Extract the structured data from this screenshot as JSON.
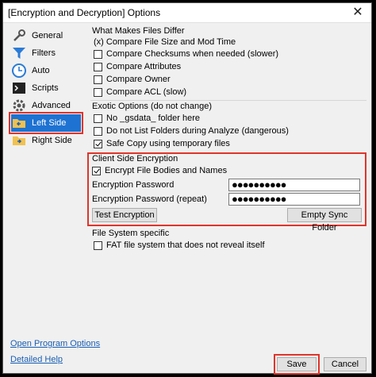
{
  "window": {
    "title": "[Encryption and Decryption] Options"
  },
  "sidebar": {
    "items": [
      {
        "label": "General",
        "icon": "wrench-icon"
      },
      {
        "label": "Filters",
        "icon": "funnel-icon"
      },
      {
        "label": "Auto",
        "icon": "clock-icon"
      },
      {
        "label": "Scripts",
        "icon": "terminal-icon"
      },
      {
        "label": "Advanced",
        "icon": "gear-icon"
      },
      {
        "label": "Left Side",
        "icon": "folder-left-icon",
        "selected": true
      },
      {
        "label": "Right Side",
        "icon": "folder-right-icon"
      }
    ]
  },
  "sections": {
    "differ": {
      "title": "What Makes Files Differ",
      "compare_size_mod": "(x) Compare File Size and Mod Time",
      "options": [
        {
          "label": "Compare Checksums when needed (slower)",
          "checked": false
        },
        {
          "label": "Compare Attributes",
          "checked": false
        },
        {
          "label": "Compare Owner",
          "checked": false
        },
        {
          "label": "Compare ACL (slow)",
          "checked": false
        }
      ]
    },
    "exotic": {
      "title": "Exotic Options (do not change)",
      "options": [
        {
          "label": "No _gsdata_ folder here",
          "checked": false
        },
        {
          "label": "Do not List Folders during Analyze (dangerous)",
          "checked": false
        },
        {
          "label": "Safe Copy using temporary files",
          "checked": true
        }
      ]
    },
    "encryption": {
      "title": "Client Side Encryption",
      "encrypt_label": "Encrypt File Bodies and Names",
      "encrypt_checked": true,
      "password_label": "Encryption Password",
      "password_value": "●●●●●●●●●●",
      "password_repeat_label": "Encryption Password (repeat)",
      "password_repeat_value": "●●●●●●●●●●",
      "test_button": "Test Encryption",
      "empty_button": "Empty Sync Folder"
    },
    "fs": {
      "title": "File System specific",
      "fat_label": "FAT file system that does not reveal itself",
      "fat_checked": false
    }
  },
  "footer": {
    "open_program_options": "Open Program Options",
    "detailed_help": "Detailed Help",
    "save": "Save",
    "cancel": "Cancel"
  },
  "colors": {
    "accent": "#1e73d2",
    "highlight": "#e0342b",
    "link": "#1a5fb4"
  }
}
